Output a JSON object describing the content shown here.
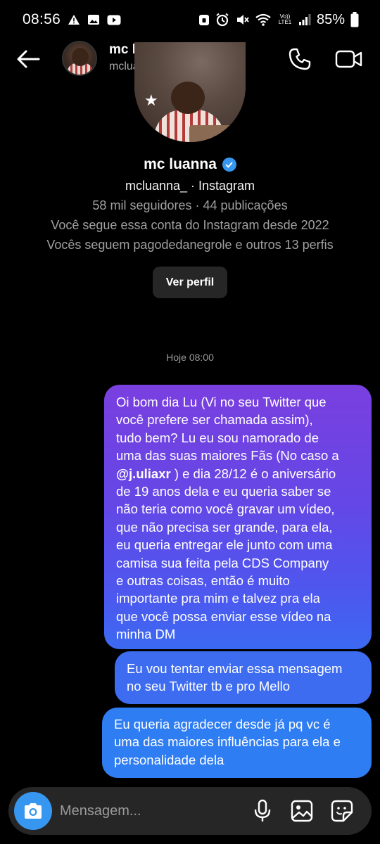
{
  "status_bar": {
    "time": "08:56",
    "battery": "85%",
    "network_label": "Vo)) LTE1"
  },
  "header": {
    "name": "mc luanna",
    "username": "mcluanna_"
  },
  "profile": {
    "name": "mc luanna",
    "subtitle": "mcluanna_ · Instagram",
    "stats": "58 mil seguidores · 44 publicações",
    "follow_since": "Você segue essa conta do Instagram desde 2022",
    "mutuals": "Vocês seguem pagodedanegrole e outros 13 perfis",
    "view_profile_label": "Ver perfil"
  },
  "chat": {
    "timestamp": "Hoje 08:00",
    "messages": [
      {
        "lines": [
          "Oi bom dia Lu (Vi no seu Twitter que",
          "você prefere ser chamada assim),",
          "tudo bem? Lu eu sou namorado de",
          "uma das suas maiores Fãs (No caso a",
          "@j.uliaxr ) e dia 28/12 é o aniversário",
          "de 19 anos dela e eu queria saber se",
          "não teria como você gravar um vídeo,",
          "que não precisa ser grande, para ela,",
          "eu queria entregar ele junto com uma",
          "camisa sua feita pela CDS Company",
          "e outras coisas, então é muito",
          "importante pra mim e talvez pra ela",
          "que você possa enviar esse vídeo na",
          "minha DM"
        ],
        "mention": "@j.uliaxr",
        "mention_rest": " ) e dia 28/12 é o aniversário"
      },
      {
        "lines": [
          "Eu vou tentar enviar essa mensagem",
          "no seu Twitter tb e pro Mello"
        ]
      },
      {
        "lines": [
          "Eu queria agradecer desde já pq vc é",
          "uma das maiores influências para ela e",
          "personalidade dela"
        ]
      }
    ]
  },
  "composer": {
    "placeholder": "Mensagem..."
  },
  "colors": {
    "accent": "#3797f0",
    "bubble_gradient_top": "#7a3fdf",
    "bubble_gradient_bottom": "#3c6af2",
    "bubble_mid": "#3d6cf0",
    "bubble_bottom": "#2f7df2",
    "composer_bg": "#262626"
  },
  "icons": [
    "back-arrow-icon",
    "phone-icon",
    "video-camera-icon",
    "verified-badge-icon",
    "camera-icon",
    "microphone-icon",
    "image-gallery-icon",
    "sticker-icon"
  ]
}
